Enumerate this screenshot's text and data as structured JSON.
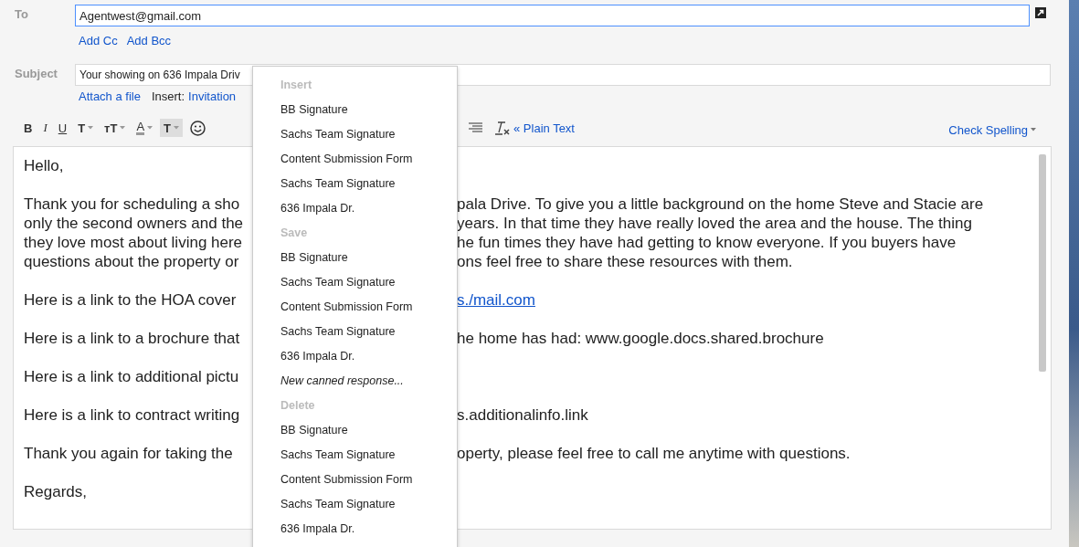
{
  "to": {
    "label": "To",
    "value": "Agentwest@gmail.com"
  },
  "cc_links": [
    "Add Cc",
    "Add Bcc"
  ],
  "subject": {
    "label": "Subject",
    "value": "Your showing on 636 Impala Driv"
  },
  "attach_link": "Attach a file",
  "insert": {
    "label": "Insert:",
    "link": "Invitation"
  },
  "toolbar": [
    {
      "kind": "bold",
      "label": "B",
      "dropdown": false
    },
    {
      "kind": "italic",
      "label": "I",
      "dropdown": false
    },
    {
      "kind": "underline",
      "label": "U",
      "dropdown": false
    },
    {
      "kind": "font",
      "label": "T",
      "dropdown": true
    },
    {
      "kind": "size",
      "label": "тT",
      "dropdown": true
    },
    {
      "kind": "color",
      "label": "A",
      "dropdown": true
    },
    {
      "kind": "highlight",
      "label": "T",
      "dropdown": true
    }
  ],
  "plain_text_link": "« Plain Text",
  "check_spelling": "Check Spelling",
  "body": [
    {
      "lines": [
        {
          "left": "Hello,"
        }
      ]
    },
    {
      "lines": [
        {
          "left": "Thank you for scheduling a sho",
          "right": "pala Drive. To give you a little background on the home Steve and Stacie are"
        },
        {
          "left": "only the second owners and the",
          "right": "years. In that time they have really loved the area and the house. The thing"
        },
        {
          "left": "they love most about living here",
          "right": "he fun times they have had getting to know everyone. If you buyers have"
        },
        {
          "left": "questions about the property or",
          "right": "ons feel free to share these resources with them."
        }
      ]
    },
    {
      "lines": [
        {
          "left": "Here is a link to the HOA cover",
          "link": "s./mail.com"
        }
      ]
    },
    {
      "lines": [
        {
          "left": "Here is a link to a brochure that",
          "right": "he home has had: www.google.docs.shared.brochure"
        }
      ]
    },
    {
      "lines": [
        {
          "left": "Here is a link to additional pictu"
        }
      ]
    },
    {
      "lines": [
        {
          "left": "Here is a link to contract writing",
          "right": "s.additionalinfo.link"
        }
      ]
    },
    {
      "lines": [
        {
          "left": "Thank you again for taking the",
          "right": "operty, please feel free to call me anytime with questions."
        }
      ]
    },
    {
      "lines": [
        {
          "left": "Regards,"
        }
      ]
    }
  ],
  "menu": [
    {
      "kind": "header",
      "label": "Insert"
    },
    {
      "kind": "item",
      "label": "BB Signature"
    },
    {
      "kind": "item",
      "label": "Sachs Team Signature"
    },
    {
      "kind": "item",
      "label": "Content Submission Form"
    },
    {
      "kind": "item",
      "label": "Sachs Team Signature"
    },
    {
      "kind": "item",
      "label": "636 Impala Dr."
    },
    {
      "kind": "header",
      "label": "Save"
    },
    {
      "kind": "item",
      "label": "BB Signature"
    },
    {
      "kind": "item",
      "label": "Sachs Team Signature"
    },
    {
      "kind": "item",
      "label": "Content Submission Form"
    },
    {
      "kind": "item",
      "label": "Sachs Team Signature"
    },
    {
      "kind": "item",
      "label": "636 Impala Dr."
    },
    {
      "kind": "action",
      "label": "New canned response..."
    },
    {
      "kind": "header",
      "label": "Delete"
    },
    {
      "kind": "item",
      "label": "BB Signature"
    },
    {
      "kind": "item",
      "label": "Sachs Team Signature"
    },
    {
      "kind": "item",
      "label": "Content Submission Form"
    },
    {
      "kind": "item",
      "label": "Sachs Team Signature"
    },
    {
      "kind": "item",
      "label": "636 Impala Dr."
    }
  ]
}
